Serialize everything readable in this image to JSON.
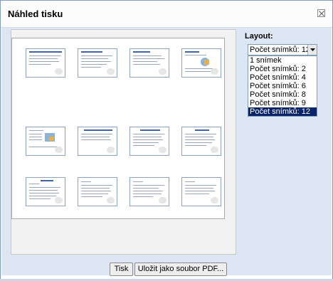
{
  "dialog": {
    "title": "Náhled tisku"
  },
  "layout": {
    "label": "Layout:",
    "selected": "Počet snímků: 12",
    "options": [
      "1 snímek",
      "Počet snímků: 2",
      "Počet snímků: 4",
      "Počet snímků: 6",
      "Počet snímků: 8",
      "Počet snímků: 9",
      "Počet snímků: 12"
    ]
  },
  "buttons": {
    "print": "Tisk",
    "save_pdf": "Uložit jako soubor PDF..."
  },
  "icons": {
    "close": "close-icon",
    "dropdown": "chevron-down-icon"
  },
  "colors": {
    "selection": "#0a246a",
    "background": "#dde7f3"
  }
}
